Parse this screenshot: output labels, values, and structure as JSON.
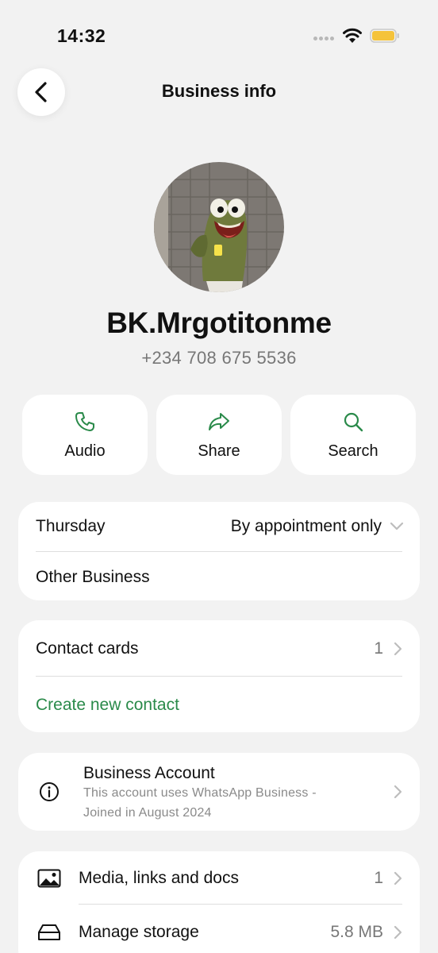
{
  "status_bar": {
    "time": "14:32"
  },
  "header": {
    "title": "Business info"
  },
  "profile": {
    "name": "BK.Mrgotitonme",
    "phone": "+234 708 675 5536"
  },
  "actions": [
    {
      "label": "Audio",
      "icon": "phone-icon"
    },
    {
      "label": "Share",
      "icon": "share-arrow-icon"
    },
    {
      "label": "Search",
      "icon": "search-icon"
    }
  ],
  "hours": {
    "day": "Thursday",
    "value": "By appointment only",
    "category": "Other Business"
  },
  "contacts": {
    "label": "Contact cards",
    "count": "1",
    "create_label": "Create new contact"
  },
  "business_account": {
    "title": "Business Account",
    "line1": "This account uses WhatsApp Business -",
    "line2": "Joined in August 2024"
  },
  "media": {
    "label": "Media, links and docs",
    "count": "1"
  },
  "storage": {
    "label": "Manage storage",
    "size": "5.8 MB"
  },
  "colors": {
    "accent_green": "#2a8a4a",
    "background": "#f2f2f2",
    "battery": "#f5c33b"
  }
}
